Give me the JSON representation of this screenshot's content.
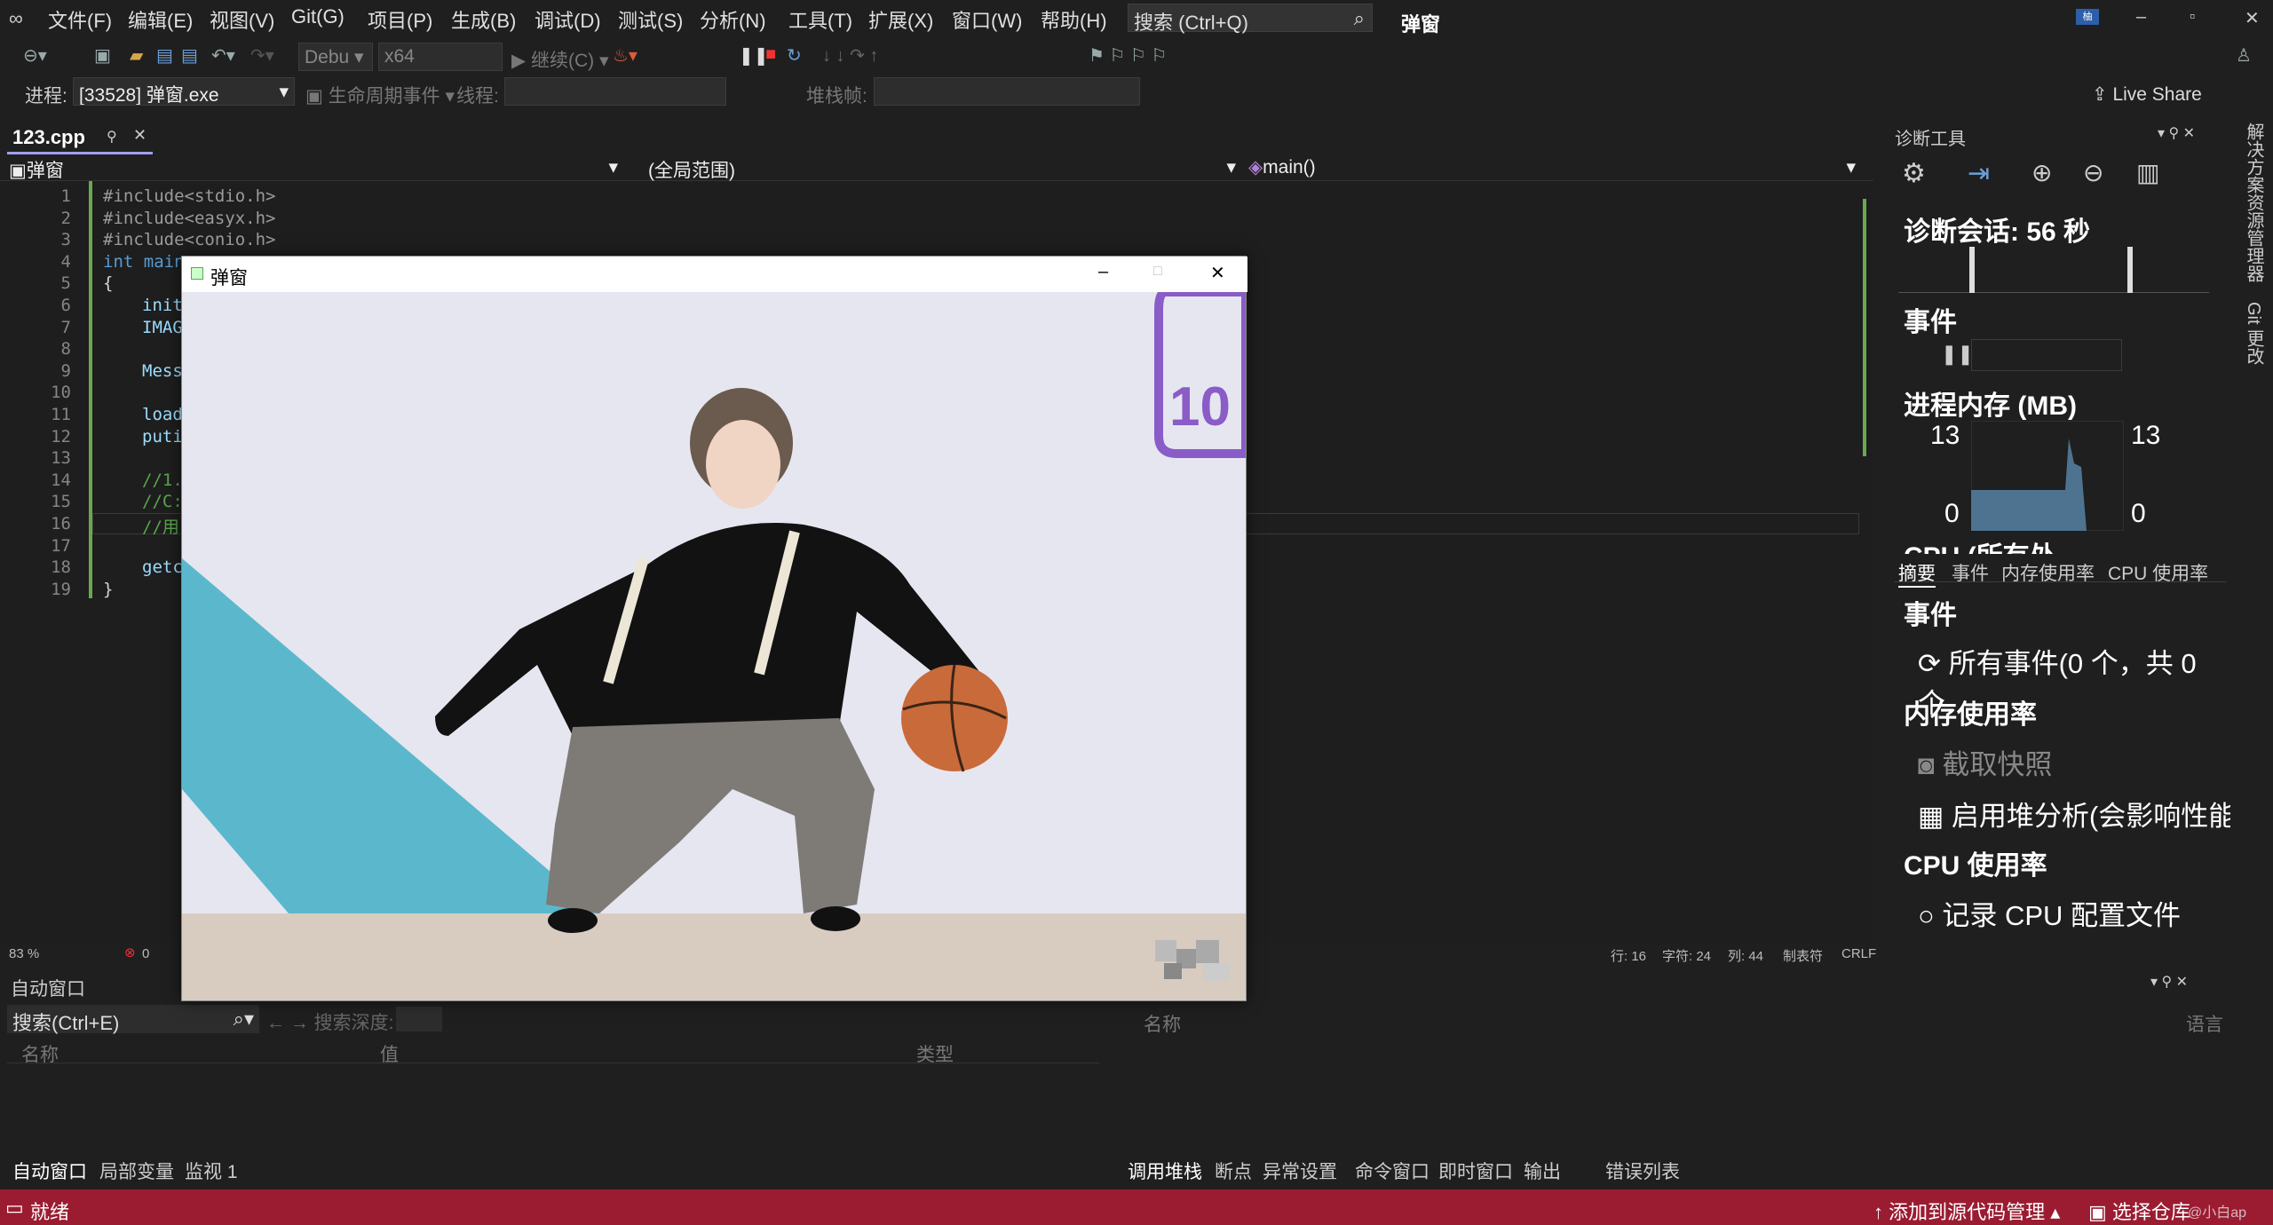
{
  "menu": [
    "文件(F)",
    "编辑(E)",
    "视图(V)",
    "Git(G)",
    "项目(P)",
    "生成(B)",
    "调试(D)",
    "测试(S)",
    "分析(N)",
    "工具(T)",
    "扩展(X)",
    "窗口(W)",
    "帮助(H)"
  ],
  "search": {
    "placeholder": "搜索 (Ctrl+Q)"
  },
  "window_title": "弹窗",
  "live_share": "Live Share",
  "toolbar": {
    "config": "Debu",
    "platform": "x64",
    "continue": "继续(C)"
  },
  "process_bar": {
    "label": "进程:",
    "process": "[33528] 弹窗.exe",
    "lifecycle": "生命周期事件",
    "thread": "线程:",
    "stack": "堆栈帧:"
  },
  "editor": {
    "tab": "123.cpp",
    "nav_project": "弹窗",
    "nav_scope": "(全局范围)",
    "nav_func": "main()",
    "line_numbers": [
      "1",
      "2",
      "3",
      "4",
      "5",
      "6",
      "7",
      "8",
      "9",
      "10",
      "11",
      "12",
      "13",
      "14",
      "15",
      "16",
      "17",
      "18",
      "19"
    ],
    "lines": [
      "#include<stdio.h>",
      "#include<easyx.h>",
      "#include<conio.h>",
      "int main",
      "{",
      "init",
      "IMAG",
      "",
      "Messa",
      "",
      "load",
      "puti",
      "",
      "//1.",
      "//C:",
      "//用",
      "",
      "getc",
      "}"
    ],
    "zoom": "83 %",
    "errors": "0",
    "status_line": "行: 16",
    "status_char": "字符: 24",
    "status_col": "列: 44",
    "status_tab": "制表符",
    "status_eol": "CRLF"
  },
  "popup": {
    "title": "弹窗",
    "min": "–",
    "max": "□",
    "close": "✕",
    "sign_text": "10"
  },
  "diag": {
    "title": "诊断工具",
    "session": "诊断会话: 56 秒",
    "events_header": "事件",
    "memory_header": "进程内存 (MB)",
    "mem_max_left": "13",
    "mem_max_right": "13",
    "mem_min_left": "0",
    "mem_min_right": "0",
    "cpu_header": "CPU (所有处",
    "tabs": [
      "摘要",
      "事件",
      "内存使用率",
      "CPU 使用率"
    ],
    "sec_events": "事件",
    "all_events": "所有事件(0 个，共 0 个",
    "sec_mem": "内存使用率",
    "snapshot": "截取快照",
    "heap": "启用堆分析(会影响性能",
    "sec_cpu": "CPU 使用率",
    "record_cpu": "记录 CPU 配置文件"
  },
  "rightstrip": {
    "text1": "解决方案资源管理器",
    "text2": "Git 更改"
  },
  "auto": {
    "title": "自动窗口",
    "search": "搜索(Ctrl+E)",
    "depth": "搜索深度:",
    "cols": [
      "名称",
      "值",
      "类型"
    ],
    "tabs": [
      "自动窗口",
      "局部变量",
      "监视 1"
    ]
  },
  "callstack": {
    "cols": [
      "名称",
      "语言"
    ],
    "tabs": [
      "调用堆栈",
      "断点",
      "异常设置",
      "命令窗口",
      "即时窗口",
      "输出",
      "错误列表"
    ]
  },
  "status": {
    "ready": "就绪",
    "add_source": "添加到源代码管理",
    "select_repo": "选择仓库",
    "watermark": "@小白ap"
  },
  "colors": {
    "accent": "#9b1c31",
    "bg": "#1f1f1f",
    "editor": "#1e1e1e",
    "chart": "#4e7391",
    "keyword": "#569cd6",
    "comment": "#57a64a",
    "include": "#d69d85"
  }
}
